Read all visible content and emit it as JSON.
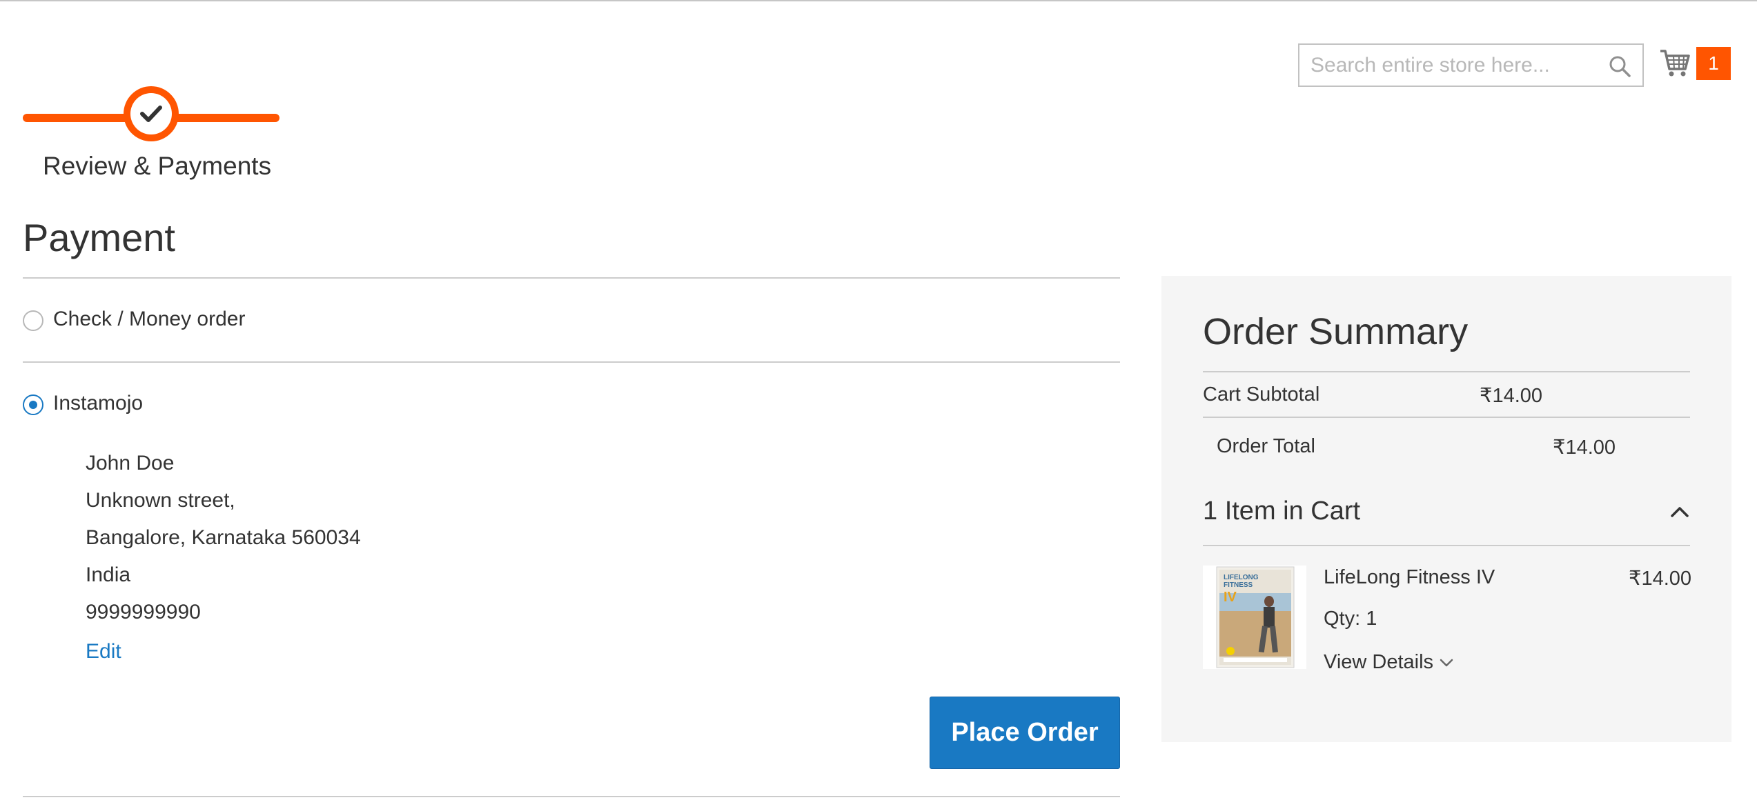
{
  "header": {
    "search_placeholder": "Search entire store here...",
    "search_icon": "search-icon",
    "cart_icon": "cart-icon",
    "cart_count": "1"
  },
  "progress": {
    "step_label": "Review & Payments",
    "step_icon": "checkmark-icon",
    "accent_color": "#ff5501"
  },
  "payment": {
    "title": "Payment",
    "methods": [
      {
        "label": "Check / Money order",
        "selected": false
      },
      {
        "label": "Instamojo",
        "selected": true
      }
    ],
    "address": {
      "name": "John Doe",
      "street": "Unknown street,",
      "city_line": "Bangalore, Karnataka 560034",
      "country": "India",
      "phone": "9999999990"
    },
    "edit_label": "Edit",
    "place_order_label": "Place Order",
    "button_color": "#1979c3"
  },
  "summary": {
    "title": "Order Summary",
    "subtotal_label": "Cart Subtotal",
    "subtotal_value": "₹14.00",
    "total_label": "Order Total",
    "total_value": "₹14.00",
    "items_title": "1 Item in Cart",
    "item": {
      "name": "LifeLong Fitness IV",
      "price": "₹14.00",
      "qty": "Qty: 1",
      "view_details": "View Details",
      "thumb_text": "LIFELONG FITNESS IV"
    }
  }
}
